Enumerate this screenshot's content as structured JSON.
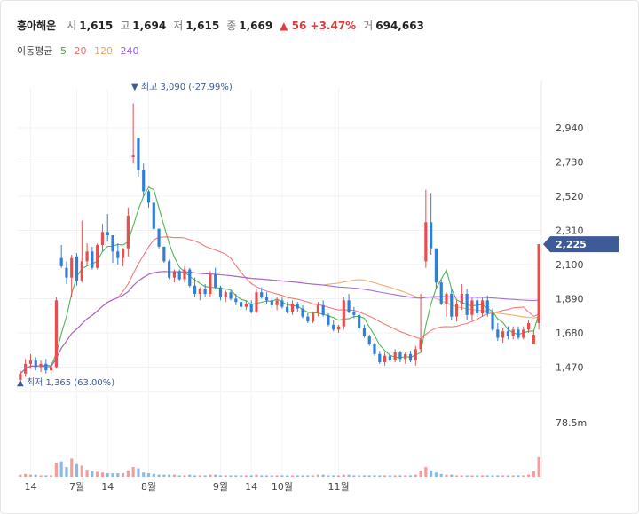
{
  "stock": {
    "name": "흥아해운",
    "open_label": "시",
    "open": "1,615",
    "high_label": "고",
    "high": "1,694",
    "low_label": "저",
    "low": "1,615",
    "close_label": "종",
    "close": "1,669",
    "change": "▲ 56 +3.47%",
    "volume_label": "거",
    "volume": "694,663"
  },
  "ma": {
    "label": "이동평균",
    "periods": [
      "5",
      "20",
      "120",
      "240"
    ],
    "colors": [
      "#3fae3f",
      "#ef6b6b",
      "#f3a35a",
      "#9a5de6"
    ]
  },
  "colors": {
    "up": "#e84e4e",
    "down": "#2f7fd6",
    "price_tag": "#3d5a99"
  },
  "annotations": {
    "max_label": "▼ 최고 3,090 (-27.99%)",
    "min_label": "▲ 최저 1,365 (63.00%)",
    "current_price": "2,225",
    "volume_tick": "78.5m"
  },
  "chart_data": {
    "type": "candlestick",
    "y_ticks": [
      "2,940",
      "2,730",
      "2,520",
      "2,310",
      "2,100",
      "1,890",
      "1,680",
      "1,470"
    ],
    "y_tick_values": [
      2940,
      2730,
      2520,
      2310,
      2100,
      1890,
      1680,
      1470
    ],
    "ylim": [
      1380,
      3180
    ],
    "x_ticks": [
      {
        "label": "14",
        "index": 2
      },
      {
        "label": "7월",
        "index": 11
      },
      {
        "label": "14",
        "index": 17
      },
      {
        "label": "8월",
        "index": 25
      },
      {
        "label": "9월",
        "index": 39
      },
      {
        "label": "14",
        "index": 45
      },
      {
        "label": "10월",
        "index": 51
      },
      {
        "label": "11월",
        "index": 62
      }
    ],
    "volume_ref": 78.5,
    "candles": [
      [
        1390,
        1450,
        1370,
        1430,
        3
      ],
      [
        1430,
        1520,
        1410,
        1490,
        4
      ],
      [
        1490,
        1550,
        1460,
        1510,
        3
      ],
      [
        1510,
        1530,
        1450,
        1470,
        3
      ],
      [
        1470,
        1510,
        1440,
        1490,
        2
      ],
      [
        1490,
        1520,
        1430,
        1450,
        2
      ],
      [
        1450,
        1500,
        1420,
        1470,
        2
      ],
      [
        1470,
        1900,
        1460,
        1880,
        20
      ],
      [
        2140,
        2220,
        2080,
        2090,
        22
      ],
      [
        2080,
        2120,
        1980,
        2020,
        14
      ],
      [
        2020,
        2160,
        1900,
        2140,
        26
      ],
      [
        2150,
        2170,
        1970,
        2000,
        18
      ],
      [
        2000,
        2370,
        1990,
        2120,
        16
      ],
      [
        2120,
        2230,
        2090,
        2180,
        10
      ],
      [
        2180,
        2210,
        2070,
        2080,
        8
      ],
      [
        2080,
        2230,
        2070,
        2220,
        7
      ],
      [
        2220,
        2350,
        2180,
        2300,
        6
      ],
      [
        2300,
        2410,
        2240,
        2280,
        5
      ],
      [
        2280,
        2260,
        2110,
        2180,
        5
      ],
      [
        2180,
        2230,
        2100,
        2140,
        5
      ],
      [
        2140,
        2200,
        2090,
        2200,
        5
      ],
      [
        2200,
        2450,
        2150,
        2400,
        9
      ],
      [
        2760,
        3090,
        2720,
        2770,
        14
      ],
      [
        2880,
        2810,
        2640,
        2680,
        12
      ],
      [
        2680,
        2720,
        2520,
        2550,
        6
      ],
      [
        2550,
        2560,
        2450,
        2480,
        5
      ],
      [
        2480,
        2420,
        2310,
        2320,
        4
      ],
      [
        2320,
        2320,
        2200,
        2210,
        3
      ],
      [
        2210,
        2200,
        2110,
        2120,
        3
      ],
      [
        2120,
        2130,
        2010,
        2020,
        3
      ],
      [
        2020,
        2070,
        1990,
        2060,
        3
      ],
      [
        2060,
        2070,
        2000,
        2010,
        2
      ],
      [
        2010,
        2090,
        1990,
        2070,
        2
      ],
      [
        2070,
        2080,
        1960,
        1970,
        3
      ],
      [
        1970,
        2020,
        1900,
        1920,
        2
      ],
      [
        1920,
        1960,
        1880,
        1950,
        2
      ],
      [
        1950,
        1980,
        1900,
        1920,
        2
      ],
      [
        1920,
        2060,
        1900,
        2040,
        3
      ],
      [
        2040,
        2080,
        1950,
        1960,
        3
      ],
      [
        1960,
        1970,
        1880,
        1900,
        2
      ],
      [
        1900,
        1940,
        1870,
        1930,
        2
      ],
      [
        1930,
        1940,
        1880,
        1890,
        2
      ],
      [
        1890,
        1920,
        1850,
        1870,
        2
      ],
      [
        1870,
        1880,
        1820,
        1840,
        2
      ],
      [
        1840,
        1880,
        1820,
        1860,
        2
      ],
      [
        1860,
        1880,
        1800,
        1810,
        2
      ],
      [
        1810,
        1950,
        1800,
        1930,
        3
      ],
      [
        1930,
        1960,
        1890,
        1900,
        2
      ],
      [
        1900,
        1930,
        1860,
        1880,
        2
      ],
      [
        1880,
        1900,
        1830,
        1850,
        2
      ],
      [
        1850,
        1900,
        1820,
        1880,
        2
      ],
      [
        1880,
        1900,
        1830,
        1840,
        2
      ],
      [
        1840,
        1870,
        1800,
        1810,
        2
      ],
      [
        1810,
        1880,
        1790,
        1860,
        2
      ],
      [
        1860,
        1870,
        1810,
        1830,
        2
      ],
      [
        1830,
        1850,
        1770,
        1780,
        2
      ],
      [
        1780,
        1800,
        1740,
        1750,
        2
      ],
      [
        1750,
        1810,
        1740,
        1800,
        2
      ],
      [
        1800,
        1870,
        1780,
        1850,
        3
      ],
      [
        1850,
        1880,
        1780,
        1790,
        3
      ],
      [
        1790,
        1800,
        1720,
        1730,
        2
      ],
      [
        1730,
        1760,
        1690,
        1700,
        2
      ],
      [
        1700,
        1730,
        1680,
        1720,
        2
      ],
      [
        1720,
        1900,
        1700,
        1880,
        3
      ],
      [
        1880,
        1920,
        1800,
        1810,
        3
      ],
      [
        1810,
        1840,
        1770,
        1790,
        2
      ],
      [
        1790,
        1800,
        1700,
        1710,
        2
      ],
      [
        1710,
        1730,
        1650,
        1660,
        2
      ],
      [
        1660,
        1670,
        1600,
        1610,
        2
      ],
      [
        1610,
        1620,
        1540,
        1550,
        2
      ],
      [
        1550,
        1570,
        1490,
        1500,
        2
      ],
      [
        1500,
        1560,
        1480,
        1540,
        2
      ],
      [
        1540,
        1560,
        1500,
        1510,
        2
      ],
      [
        1510,
        1580,
        1500,
        1560,
        2
      ],
      [
        1560,
        1570,
        1500,
        1520,
        2
      ],
      [
        1520,
        1560,
        1490,
        1550,
        2
      ],
      [
        1550,
        1570,
        1500,
        1510,
        2
      ],
      [
        1510,
        1600,
        1480,
        1580,
        3
      ],
      [
        1580,
        1920,
        1560,
        1640,
        9
      ],
      [
        2120,
        2560,
        2080,
        2360,
        14
      ],
      [
        2360,
        2540,
        2160,
        2200,
        9
      ],
      [
        2200,
        2130,
        1950,
        1990,
        6
      ],
      [
        1990,
        2010,
        1850,
        1860,
        4
      ],
      [
        1860,
        1930,
        1780,
        1920,
        3
      ],
      [
        1920,
        1950,
        1760,
        1780,
        3
      ],
      [
        1780,
        1880,
        1750,
        1860,
        2
      ],
      [
        1860,
        1980,
        1820,
        1920,
        2
      ],
      [
        1920,
        1950,
        1760,
        1790,
        2
      ],
      [
        1790,
        1900,
        1760,
        1880,
        2
      ],
      [
        1880,
        1900,
        1780,
        1800,
        2
      ],
      [
        1800,
        1900,
        1780,
        1880,
        2
      ],
      [
        1880,
        1910,
        1780,
        1800,
        2
      ],
      [
        1800,
        1830,
        1690,
        1700,
        2
      ],
      [
        1700,
        1740,
        1630,
        1650,
        2
      ],
      [
        1650,
        1710,
        1620,
        1690,
        2
      ],
      [
        1690,
        1720,
        1640,
        1660,
        2
      ],
      [
        1660,
        1720,
        1640,
        1700,
        2
      ],
      [
        1700,
        1720,
        1640,
        1650,
        2
      ],
      [
        1650,
        1720,
        1640,
        1700,
        2
      ],
      [
        1700,
        1760,
        1680,
        1740,
        3
      ],
      [
        1615,
        1694,
        1615,
        1669,
        8
      ],
      [
        1740,
        2225,
        1700,
        2225,
        28
      ]
    ]
  }
}
